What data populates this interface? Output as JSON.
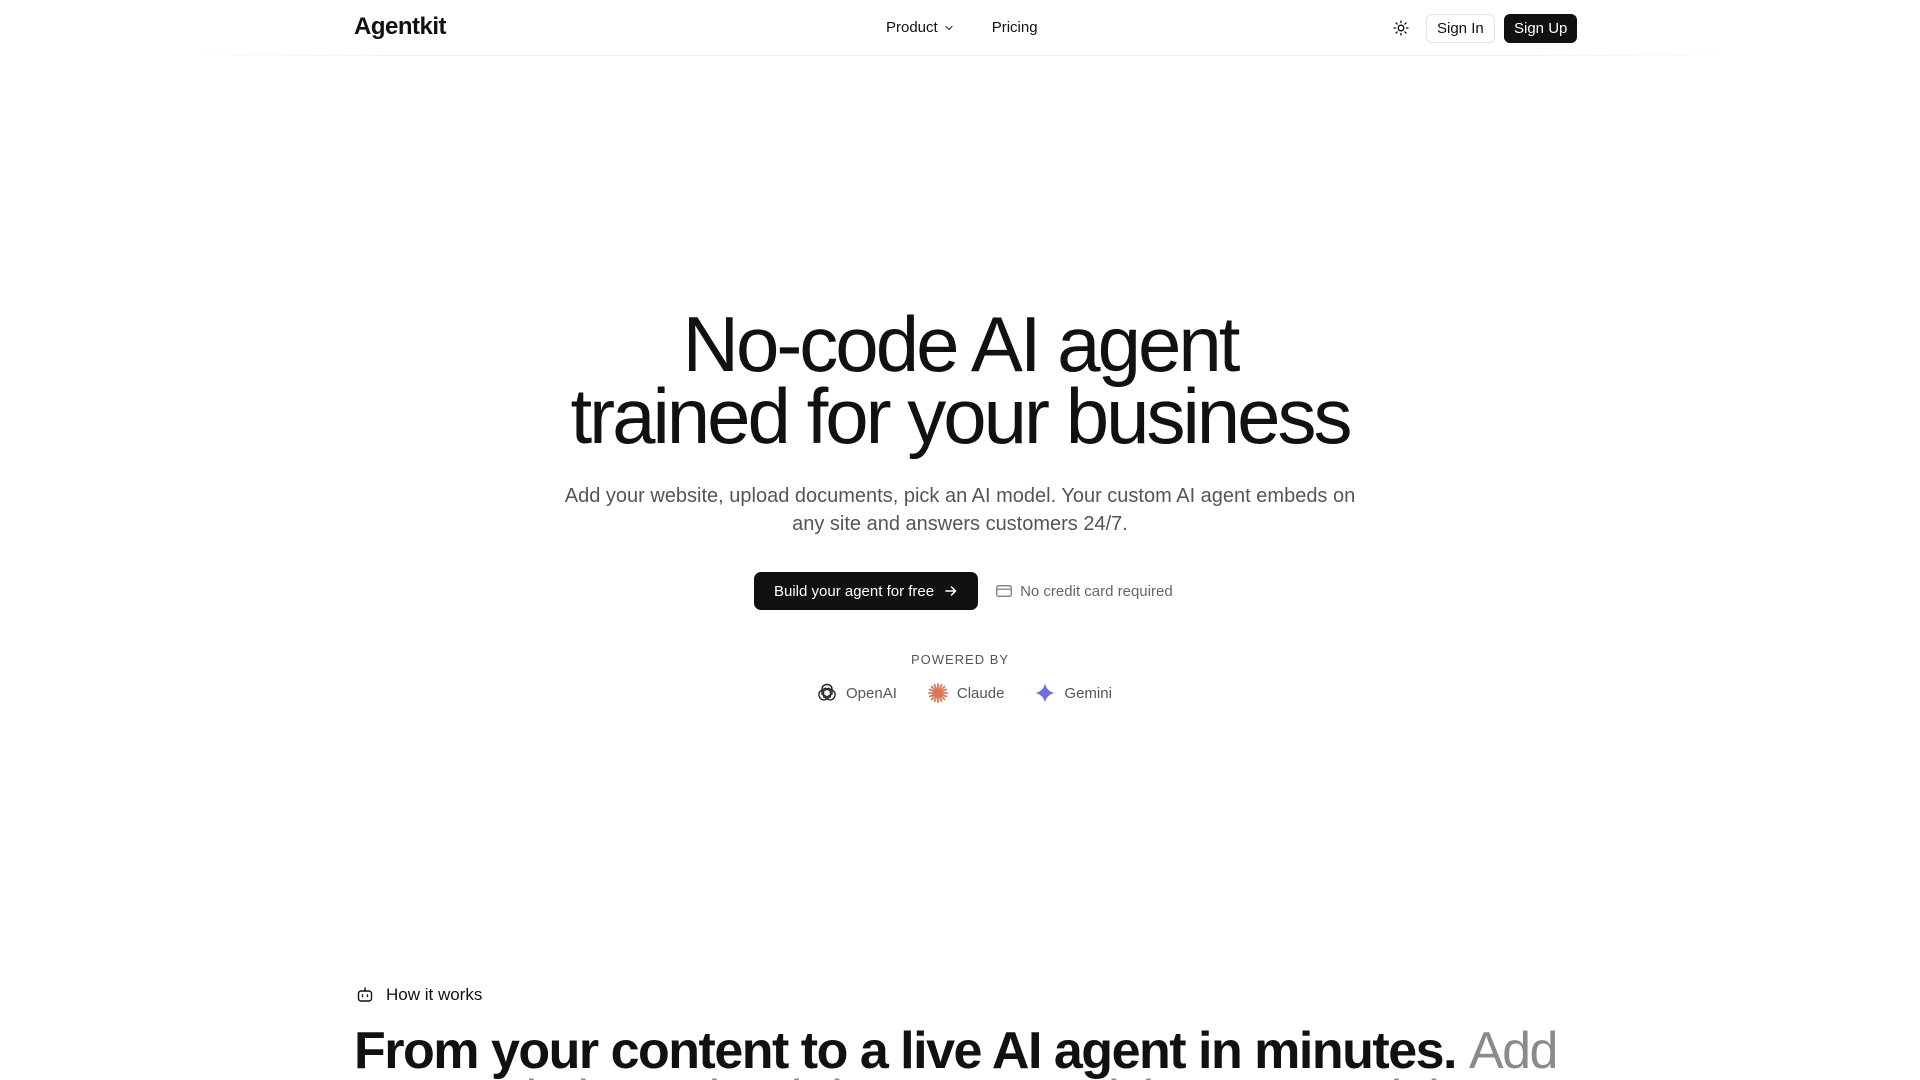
{
  "header": {
    "logo": "Agentkit",
    "nav": [
      {
        "label": "Product",
        "has_dropdown": true
      },
      {
        "label": "Pricing",
        "has_dropdown": false
      }
    ],
    "theme_toggle_icon": "sun-icon",
    "sign_in_label": "Sign In",
    "sign_up_label": "Sign Up"
  },
  "hero": {
    "title_line1": "No-code AI agent",
    "title_line2": "trained for your business",
    "subtitle": "Add your website, upload documents, pick an AI model. Your custom AI agent embeds on any site and answers customers 24/7.",
    "cta_label": "Build your agent for free",
    "cta_icon": "arrow-right-icon",
    "no_credit_card": "No credit card required",
    "no_credit_card_icon": "credit-card-icon",
    "powered_by_label": "POWERED BY",
    "providers": [
      {
        "name": "OpenAI",
        "icon": "openai-icon",
        "color": "#222222"
      },
      {
        "name": "Claude",
        "icon": "claude-icon",
        "color": "#d97757"
      },
      {
        "name": "Gemini",
        "icon": "gemini-icon",
        "color": "#6b5bd6"
      }
    ]
  },
  "how_it_works": {
    "label": "How it works",
    "icon": "robot-icon",
    "heading_strong": "From your content to a live AI agent in minutes.",
    "heading_muted": "Add",
    "heading_line2": "your website, upload documents, pick an AI model."
  },
  "colors": {
    "primary": "#111111",
    "muted_text": "#555555",
    "border": "#e3e3e3",
    "background": "#ffffff"
  }
}
